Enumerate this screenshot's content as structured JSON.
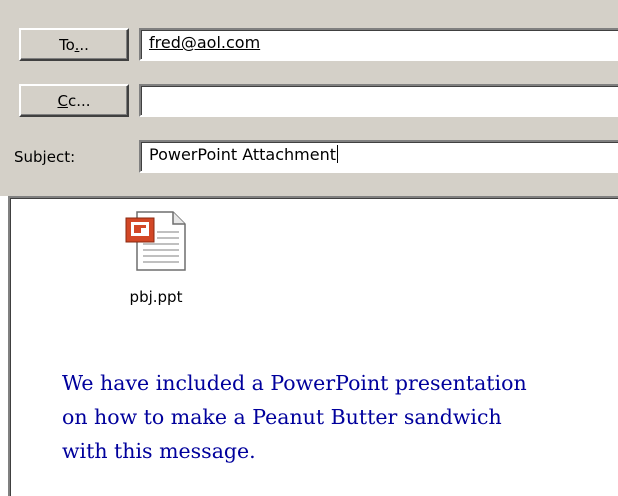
{
  "header": {
    "to_button": {
      "pre": "To",
      "accel": ".",
      "post": ".."
    },
    "cc_button": {
      "accel": "C",
      "post": "c..."
    },
    "subject_label": "Subject:"
  },
  "fields": {
    "to_value": "fred@aol.com",
    "cc_value": "",
    "subject_value": "PowerPoint Attachment"
  },
  "attachment": {
    "filename": "pbj.ppt",
    "icon": "powerpoint-file-icon"
  },
  "message": {
    "lines": [
      "We have included a PowerPoint presentation",
      "on how to make a Peanut Butter sandwich",
      "with this message."
    ]
  },
  "colors": {
    "chrome": "#d4d0c8",
    "message_text": "#00009c",
    "ppt_orange": "#d24726"
  }
}
